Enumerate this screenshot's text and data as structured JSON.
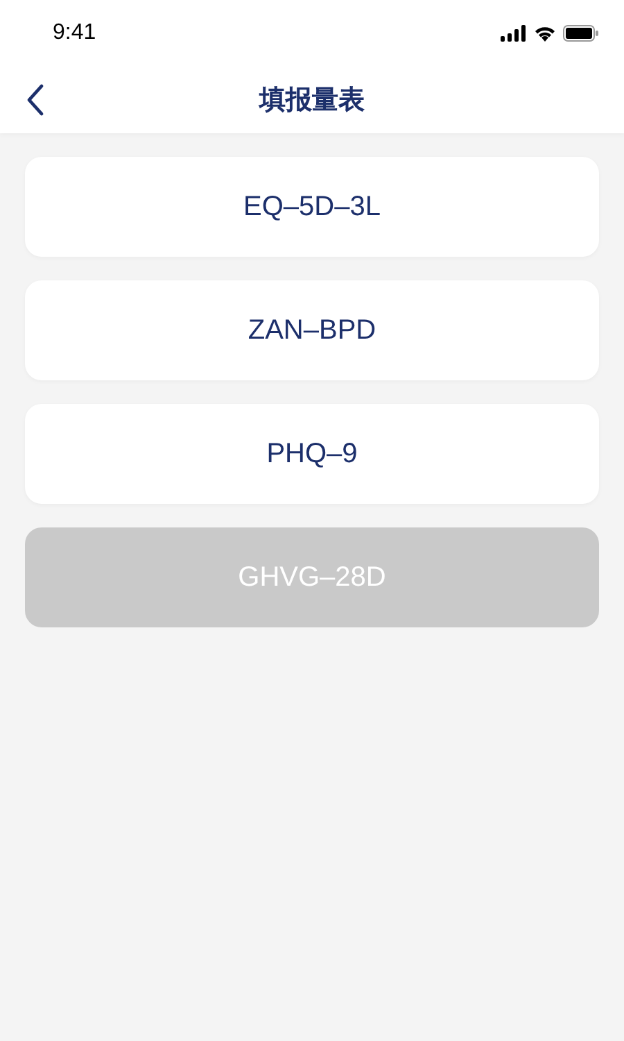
{
  "status_bar": {
    "time": "9:41"
  },
  "nav_bar": {
    "title": "填报量表"
  },
  "scales": [
    {
      "label": "EQ–5D–3L",
      "disabled": false
    },
    {
      "label": "ZAN–BPD",
      "disabled": false
    },
    {
      "label": "PHQ–9",
      "disabled": false
    },
    {
      "label": "GHVG–28D",
      "disabled": true
    }
  ]
}
